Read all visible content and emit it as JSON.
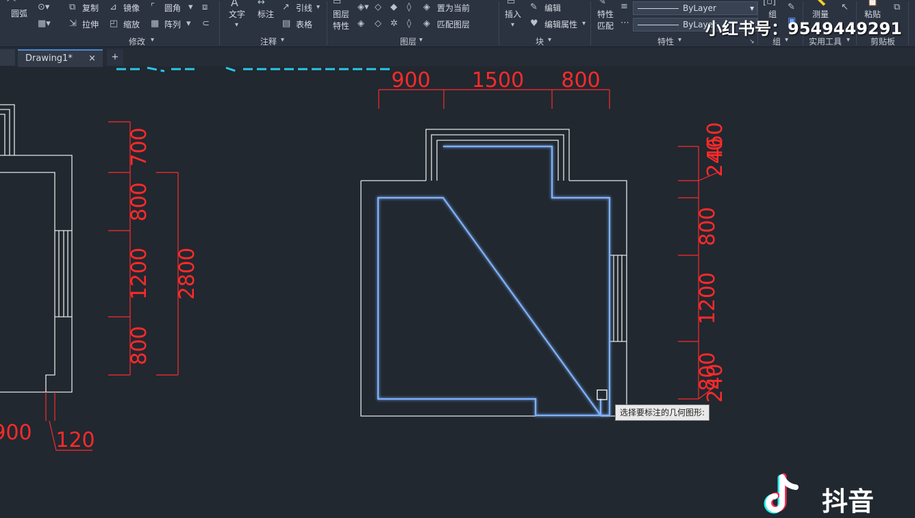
{
  "ribbon": {
    "modify": {
      "arc": "圆弧",
      "copy": "复制",
      "mirror": "镜像",
      "fillet": "圆角",
      "stretch": "拉伸",
      "scale": "缩放",
      "array": "阵列",
      "group_label": "修改"
    },
    "annotation": {
      "text": "文字",
      "dimension": "标注",
      "leader": "引线",
      "table": "表格",
      "group_label": "注释"
    },
    "layers": {
      "layer_props_1": "图层",
      "layer_props_2": "特性",
      "set_current": "置为当前",
      "match_layer": "匹配图层",
      "group_label": "图层"
    },
    "block": {
      "insert": "插入",
      "edit": "编辑",
      "edit_attr": "编辑属性",
      "group_label": "块"
    },
    "properties": {
      "match_1": "特性",
      "match_2": "匹配",
      "bylayer1": "ByLayer",
      "bylayer2": "ByLayer",
      "group_label": "特性"
    },
    "groups": {
      "group": "组",
      "group_label": "组"
    },
    "utilities": {
      "measure": "测量",
      "group_label": "实用工具"
    },
    "clipboard": {
      "paste": "粘贴",
      "group_label": "剪贴板"
    }
  },
  "tabs": {
    "drawing": "Drawing1*",
    "close": "×",
    "new": "+"
  },
  "drawing": {
    "top_dims": [
      "900",
      "1500",
      "800"
    ],
    "right_dims": [
      "460",
      "240",
      "800",
      "1200",
      "800",
      "240"
    ],
    "left_dims": [
      "700",
      "800",
      "1200",
      "800"
    ],
    "left_total": "2800",
    "left_bottom": [
      "900",
      "120"
    ],
    "colors": {
      "dimension": "#ff2a2a",
      "wall": "#e6e6e6",
      "highlight": "#7fb2ff",
      "cyan": "#29c8e6"
    }
  },
  "tooltip": "选择要标注的几何图形:",
  "watermark": "小红书号：9549449291",
  "logo_text": "抖音"
}
